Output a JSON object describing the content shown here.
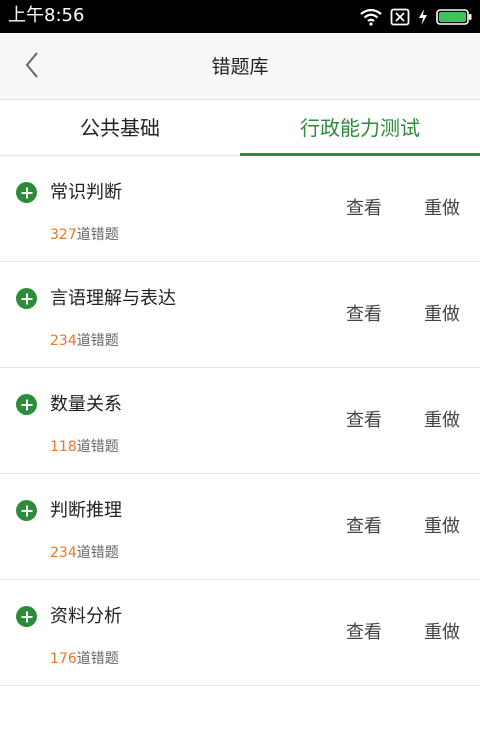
{
  "status_bar": {
    "time": "上午8:56",
    "icons": [
      "wifi-icon",
      "sim-disabled-icon",
      "charging-icon",
      "battery-icon"
    ],
    "battery_color": "#3bc45a"
  },
  "nav": {
    "title": "错题库",
    "back_icon": "chevron-left-icon"
  },
  "tabs": [
    {
      "label": "公共基础",
      "active": false
    },
    {
      "label": "行政能力测试",
      "active": true
    }
  ],
  "accent_color": "#2e8b3a",
  "count_color": "#e8762b",
  "items": [
    {
      "title": "常识判断",
      "count": "327",
      "count_suffix": "道错题",
      "view_label": "查看",
      "redo_label": "重做"
    },
    {
      "title": "言语理解与表达",
      "count": "234",
      "count_suffix": "道错题",
      "view_label": "查看",
      "redo_label": "重做"
    },
    {
      "title": "数量关系",
      "count": "118",
      "count_suffix": "道错题",
      "view_label": "查看",
      "redo_label": "重做"
    },
    {
      "title": "判断推理",
      "count": "234",
      "count_suffix": "道错题",
      "view_label": "查看",
      "redo_label": "重做"
    },
    {
      "title": "资料分析",
      "count": "176",
      "count_suffix": "道错题",
      "view_label": "查看",
      "redo_label": "重做"
    }
  ]
}
